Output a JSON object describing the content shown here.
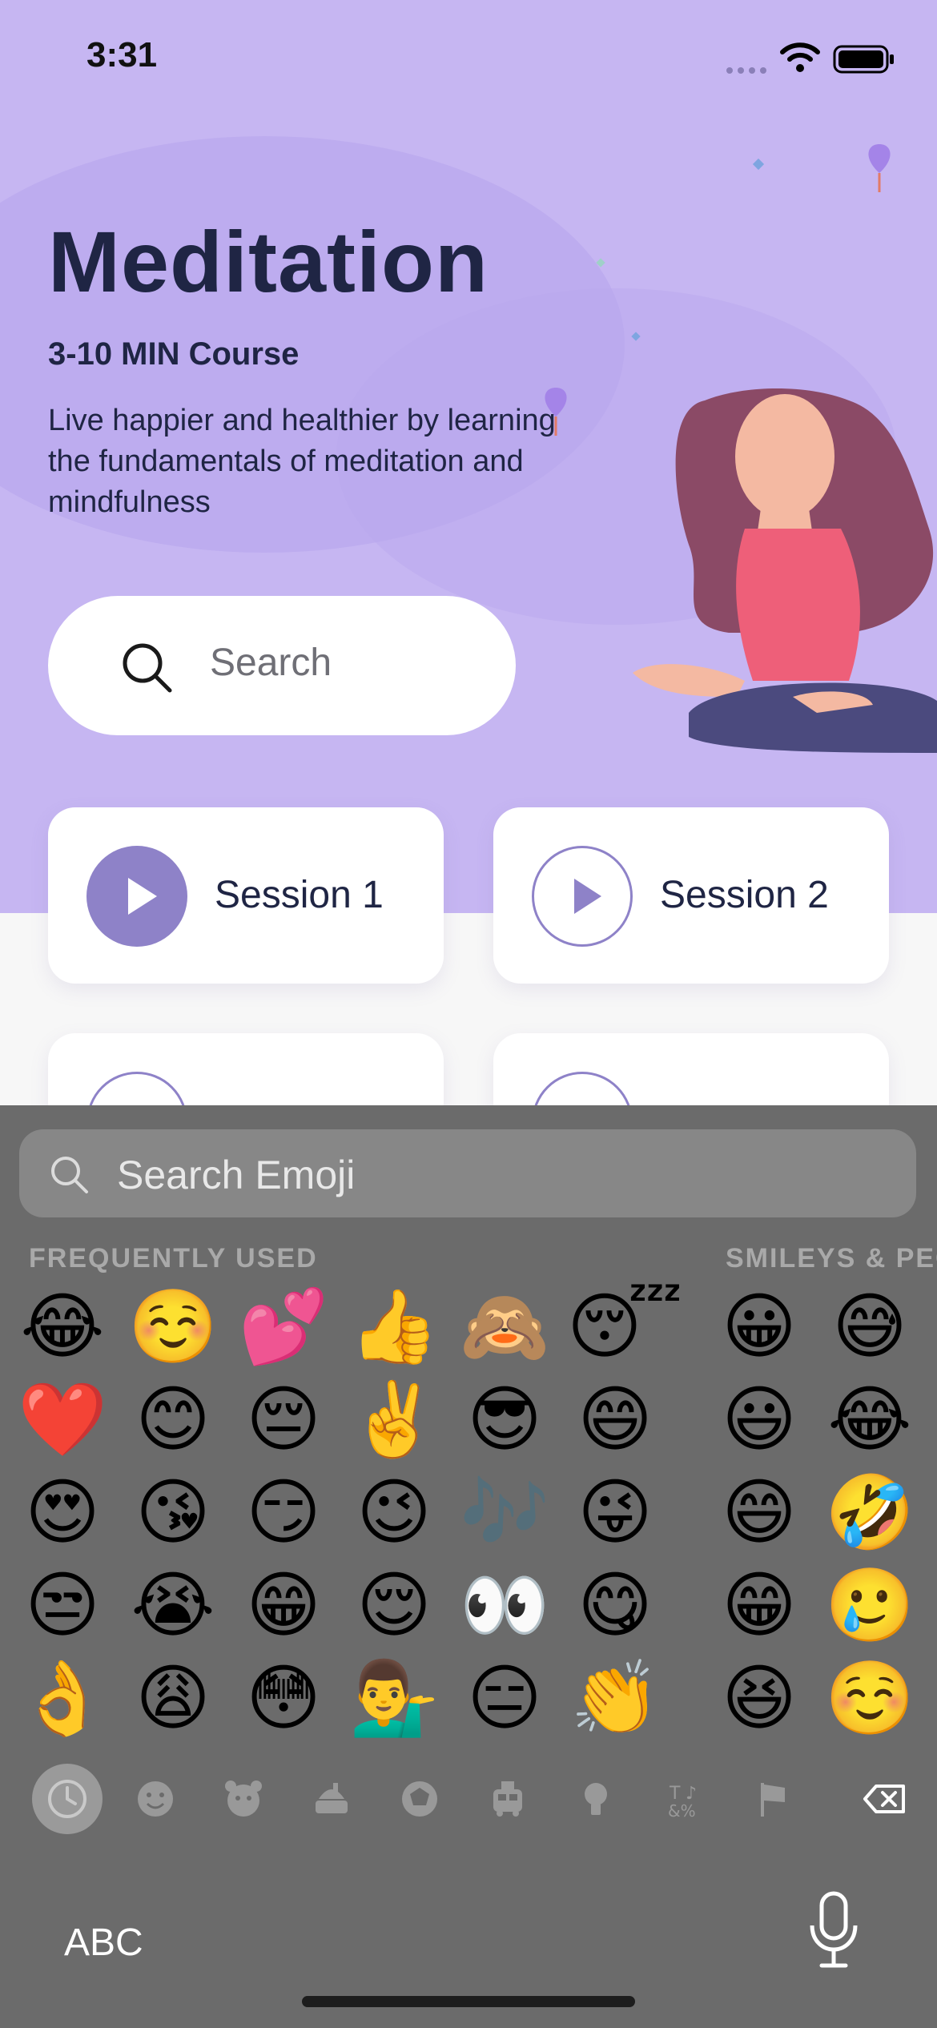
{
  "status": {
    "time": "3:31"
  },
  "hero": {
    "title": "Meditation",
    "subtitle": "3-10 MIN Course",
    "description": "Live happier and healthier by learning the fundamentals of meditation and mindfulness"
  },
  "search": {
    "placeholder": "Search"
  },
  "sessions": [
    {
      "label": "Session 1"
    },
    {
      "label": "Session 2"
    }
  ],
  "keyboard": {
    "search_placeholder": "Search Emoji",
    "sections": [
      "FREQUENTLY USED",
      "SMILEYS & PEOPLE"
    ],
    "frequently_used": [
      [
        "😂",
        "☺️",
        "💕",
        "👍",
        "🙈",
        "😴"
      ],
      [
        "❤️",
        "😊",
        "😔",
        "✌️",
        "😎",
        "😄"
      ],
      [
        "😍",
        "😘",
        "😏",
        "😉",
        "🎶",
        "😜"
      ],
      [
        "😒",
        "😭",
        "😁",
        "😌",
        "👀",
        "😋"
      ],
      [
        "👌",
        "😩",
        "😳",
        "💁‍♂️",
        "😑",
        "👏"
      ]
    ],
    "smileys": [
      [
        "😀",
        "😅"
      ],
      [
        "😃",
        "😂"
      ],
      [
        "😄",
        "🤣"
      ],
      [
        "😁",
        "🥲"
      ],
      [
        "😆",
        "☺️"
      ]
    ],
    "abc_label": "ABC",
    "categories": [
      "recent-icon",
      "smiley-icon",
      "animal-icon",
      "food-icon",
      "sports-icon",
      "travel-icon",
      "objects-icon",
      "symbols-icon",
      "flags-icon",
      "delete-icon"
    ]
  },
  "colors": {
    "hero_bg": "#c6b6f2",
    "accent": "#8e82c8",
    "title": "#1f2544",
    "keyboard_bg": "#6b6b6b"
  }
}
